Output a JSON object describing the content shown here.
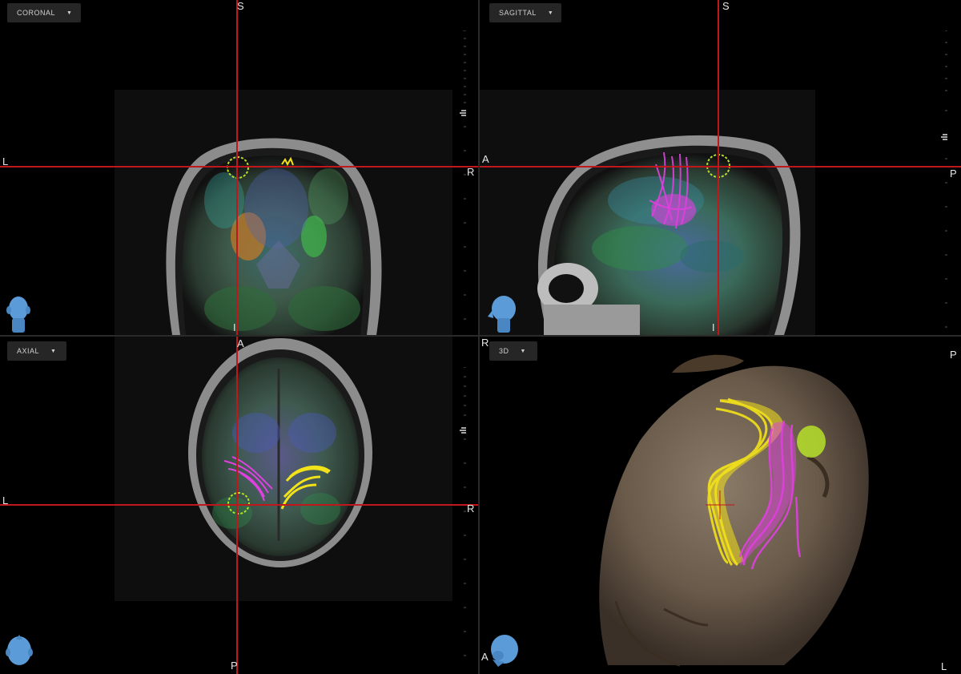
{
  "views": {
    "coronal": {
      "label": "CORONAL",
      "orient": {
        "top": "S",
        "left": "L",
        "right": "R",
        "bottom": "I"
      }
    },
    "sagittal": {
      "label": "SAGITTAL",
      "orient": {
        "top": "S",
        "left": "A",
        "right": "P",
        "bottom": "I"
      }
    },
    "axial": {
      "label": "AXIAL",
      "orient": {
        "top": "A",
        "left": "L",
        "right": "R",
        "bottom": "P"
      }
    },
    "three_d": {
      "label": "3D",
      "orient": {
        "top_right": "P",
        "bottom_left": "A",
        "bottom_right": "L",
        "below_sagittal": "R"
      }
    }
  },
  "icons": {
    "dropdown": "caret-down-icon",
    "orientation": "head-orientation-icon"
  },
  "colors": {
    "crosshair": "#c0171c",
    "tract_yellow": "#f2e21a",
    "tract_magenta": "#e040e0",
    "roi_green": "#b6e02a",
    "head_icon": "#5b9bd8",
    "button_bg": "#262626"
  }
}
